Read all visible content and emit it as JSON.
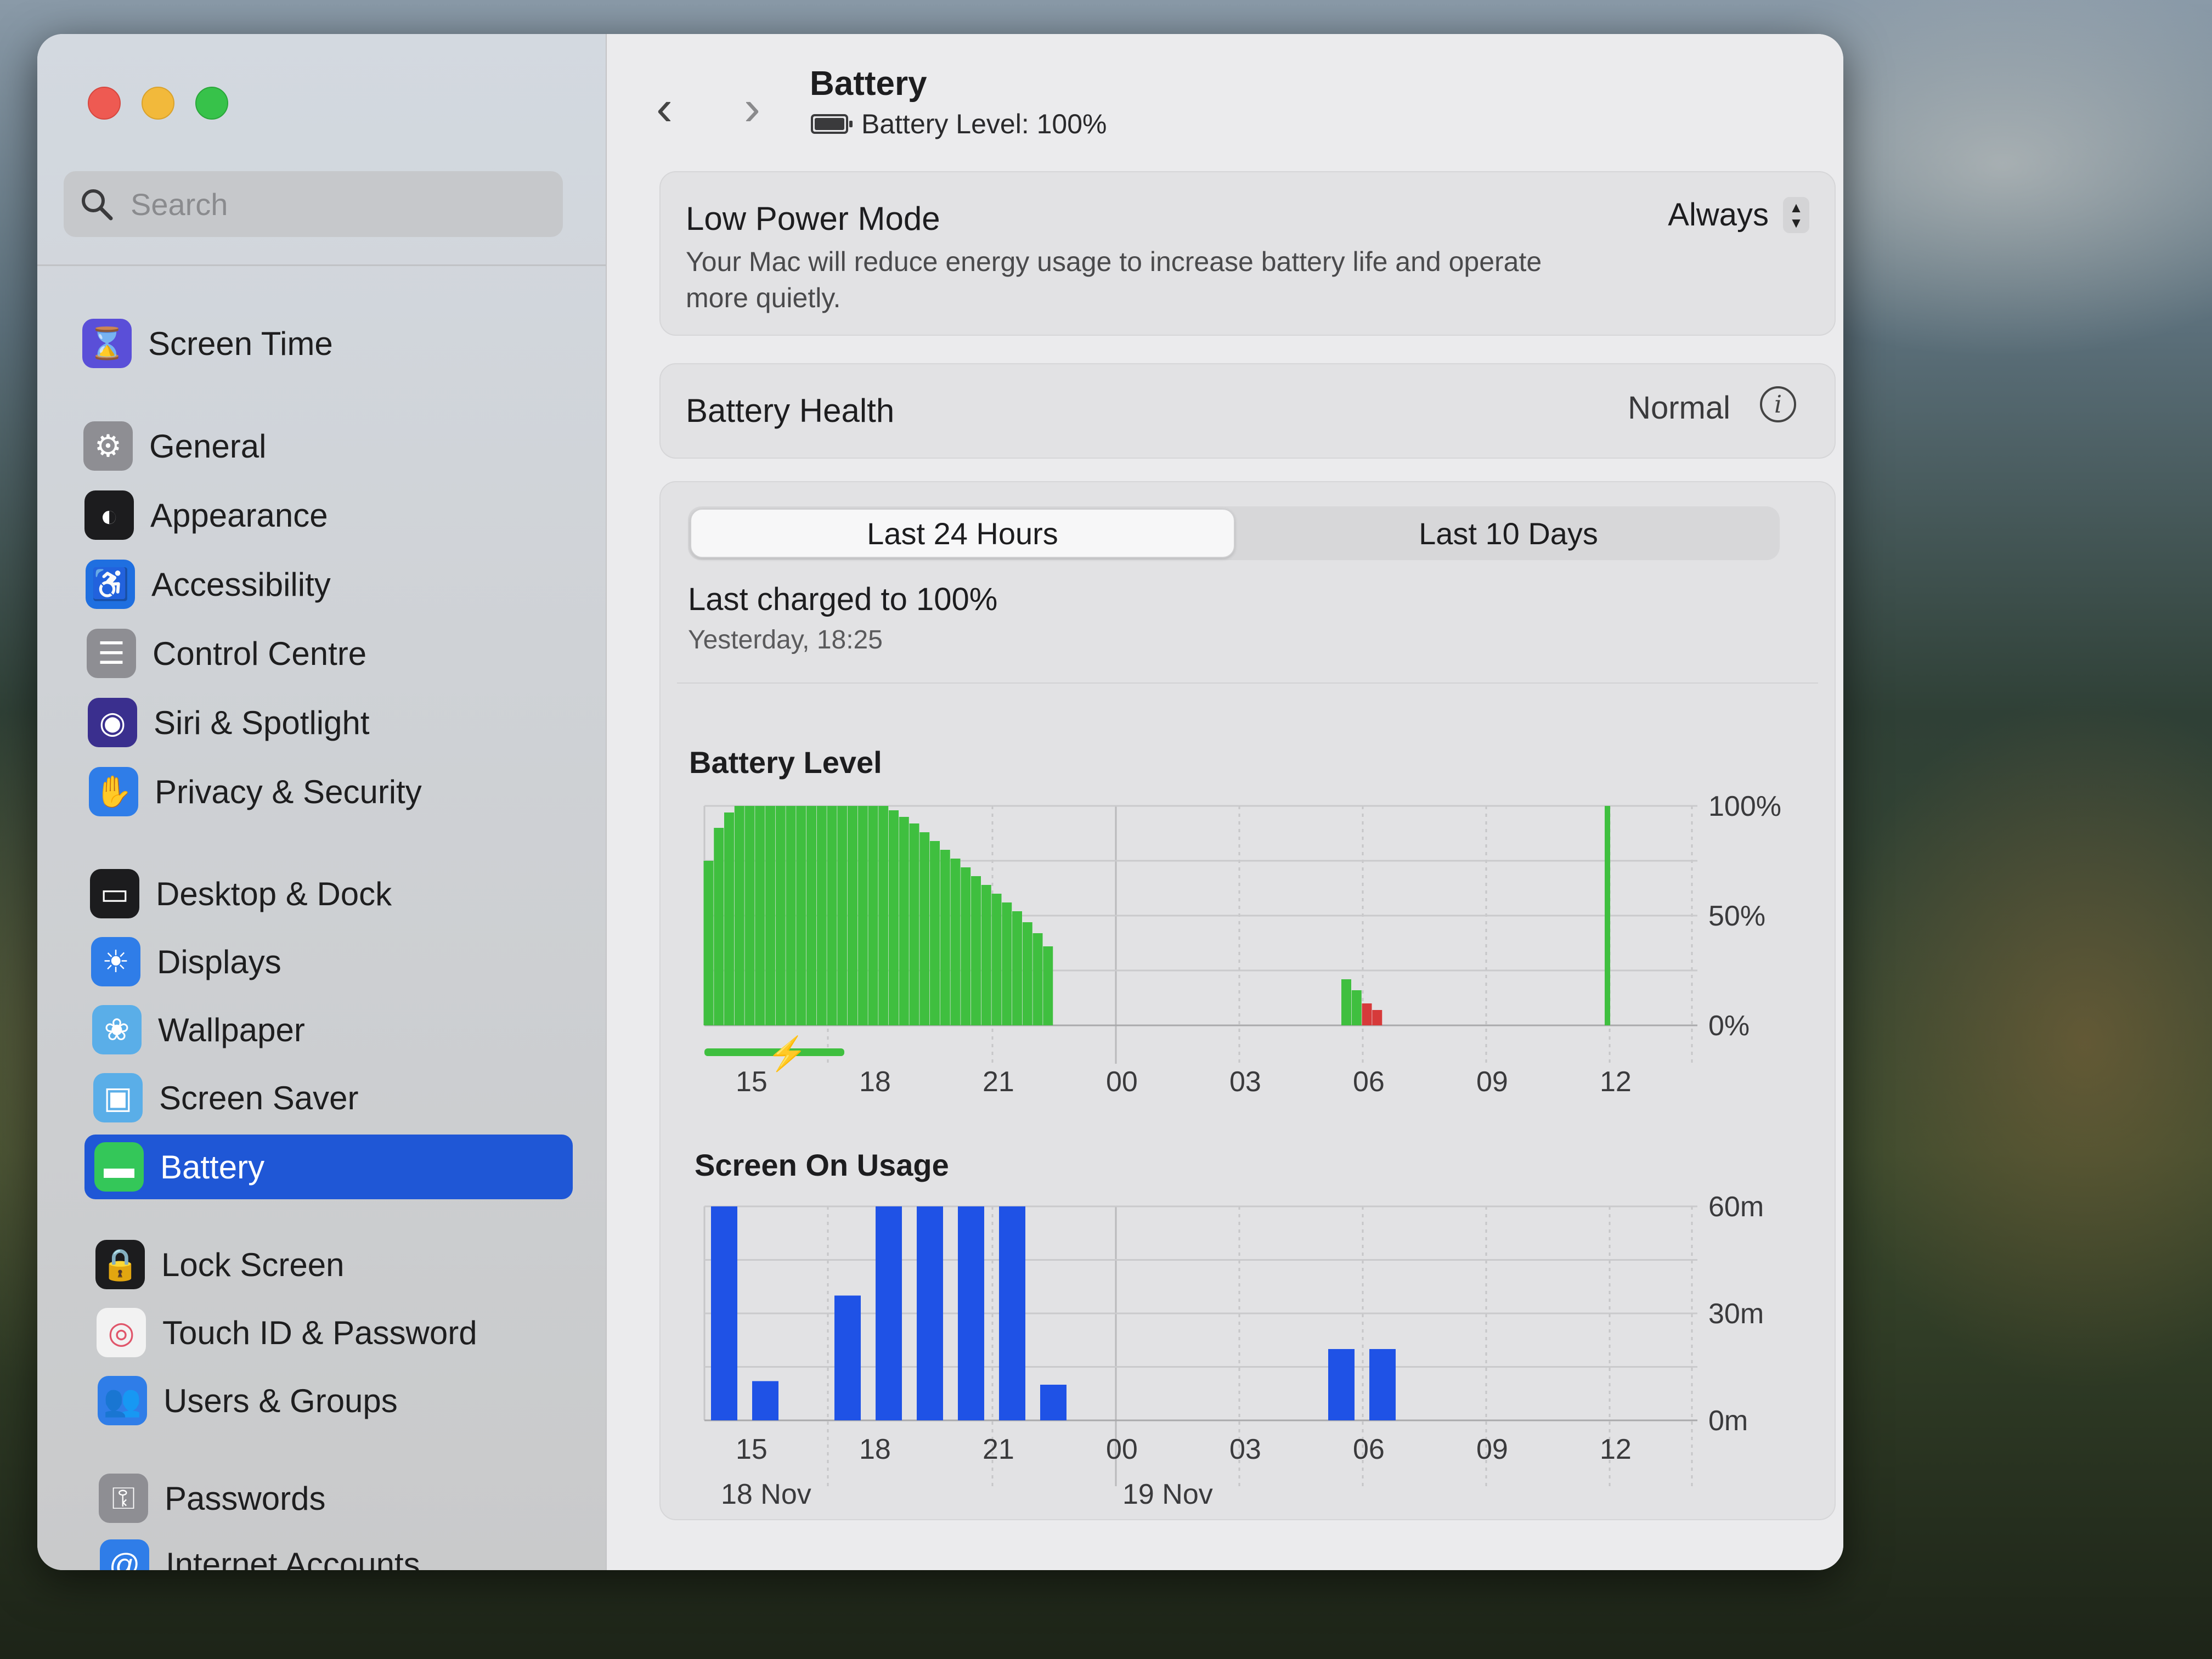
{
  "window": {
    "title": "Battery",
    "subtitle": "Battery Level: 100%"
  },
  "sidebar": {
    "search_placeholder": "Search",
    "items": [
      {
        "label": "Screen Time",
        "icon": "hourglass-icon",
        "color": "#5a4fd8"
      },
      {
        "label": "General",
        "icon": "gear-icon",
        "color": "#8e8e93"
      },
      {
        "label": "Appearance",
        "icon": "appearance-icon",
        "color": "#1c1c1e"
      },
      {
        "label": "Accessibility",
        "icon": "accessibility-icon",
        "color": "#1f6fe0"
      },
      {
        "label": "Control Centre",
        "icon": "control-centre-icon",
        "color": "#8e8e93"
      },
      {
        "label": "Siri & Spotlight",
        "icon": "siri-icon",
        "color": "#3a2f8e"
      },
      {
        "label": "Privacy & Security",
        "icon": "hand-icon",
        "color": "#2f7de8"
      },
      {
        "label": "Desktop & Dock",
        "icon": "dock-icon",
        "color": "#1c1c1e"
      },
      {
        "label": "Displays",
        "icon": "sun-icon",
        "color": "#2f7de8"
      },
      {
        "label": "Wallpaper",
        "icon": "wallpaper-icon",
        "color": "#5aaee8"
      },
      {
        "label": "Screen Saver",
        "icon": "screen-saver-icon",
        "color": "#5aaee8"
      },
      {
        "label": "Battery",
        "icon": "battery-icon",
        "color": "#34c759",
        "active": true
      },
      {
        "label": "Lock Screen",
        "icon": "lock-icon",
        "color": "#1c1c1e"
      },
      {
        "label": "Touch ID & Password",
        "icon": "fingerprint-icon",
        "color": "#f2f2f2"
      },
      {
        "label": "Users & Groups",
        "icon": "users-icon",
        "color": "#2f7de8"
      },
      {
        "label": "Passwords",
        "icon": "key-icon",
        "color": "#8e8e93"
      },
      {
        "label": "Internet Accounts",
        "icon": "at-icon",
        "color": "#2f7de8"
      }
    ]
  },
  "low_power": {
    "title": "Low Power Mode",
    "description": "Your Mac will reduce energy usage to increase battery life and operate more quietly.",
    "value": "Always"
  },
  "health": {
    "title": "Battery Health",
    "value": "Normal"
  },
  "usage": {
    "tabs": [
      "Last 24 Hours",
      "Last 10 Days"
    ],
    "selected_tab": "Last 24 Hours",
    "last_charged": "Last charged to 100%",
    "last_charged_time": "Yesterday, 18:25"
  },
  "chart_data": [
    {
      "type": "bar",
      "title": "Battery Level",
      "x_ticks": [
        "15",
        "18",
        "21",
        "00",
        "03",
        "06",
        "09",
        "12"
      ],
      "y_ticks": [
        "100%",
        "50%",
        "0%"
      ],
      "ylim": [
        0,
        100
      ],
      "bar_hours": [
        14.1,
        14.35,
        14.6,
        14.85,
        15.1,
        15.35,
        15.6,
        15.85,
        16.1,
        16.35,
        16.6,
        16.85,
        17.1,
        17.35,
        17.6,
        17.85,
        18.1,
        18.35,
        18.6,
        18.85,
        19.1,
        19.35,
        19.6,
        19.85,
        20.1,
        20.35,
        20.6,
        20.85,
        21.1,
        21.35,
        21.6,
        21.85,
        22.1,
        22.35,
        29.6,
        29.85,
        30.1,
        30.35,
        36.0
      ],
      "values": [
        75,
        90,
        97,
        100,
        100,
        100,
        100,
        100,
        100,
        100,
        100,
        100,
        100,
        100,
        100,
        100,
        100,
        100,
        98,
        95,
        92,
        88,
        84,
        80,
        76,
        72,
        68,
        64,
        60,
        56,
        52,
        47,
        42,
        36,
        21,
        16,
        10,
        7,
        100
      ],
      "colors_by_bar": [
        "green",
        "green",
        "green",
        "green",
        "green",
        "green",
        "green",
        "green",
        "green",
        "green",
        "green",
        "green",
        "green",
        "green",
        "green",
        "green",
        "green",
        "green",
        "green",
        "green",
        "green",
        "green",
        "green",
        "green",
        "green",
        "green",
        "green",
        "green",
        "green",
        "green",
        "green",
        "green",
        "green",
        "green",
        "green",
        "green",
        "red",
        "red",
        "green"
      ],
      "charging_range_hours": [
        14.0,
        17.4
      ],
      "series_colors": {
        "green": "#3fbf3f",
        "red": "#d63a3a"
      }
    },
    {
      "type": "bar",
      "title": "Screen On Usage",
      "x_ticks": [
        "15",
        "18",
        "21",
        "00",
        "03",
        "06",
        "09",
        "12"
      ],
      "y_ticks": [
        "60m",
        "30m",
        "0m"
      ],
      "date_labels": [
        "18 Nov",
        "19 Nov"
      ],
      "ylim": [
        0,
        60
      ],
      "hours": [
        14,
        15,
        17,
        18,
        19,
        20,
        21,
        22,
        29,
        30
      ],
      "values": [
        60,
        11,
        35,
        60,
        60,
        60,
        60,
        10,
        20,
        20
      ],
      "color": "#1f52e6"
    }
  ]
}
